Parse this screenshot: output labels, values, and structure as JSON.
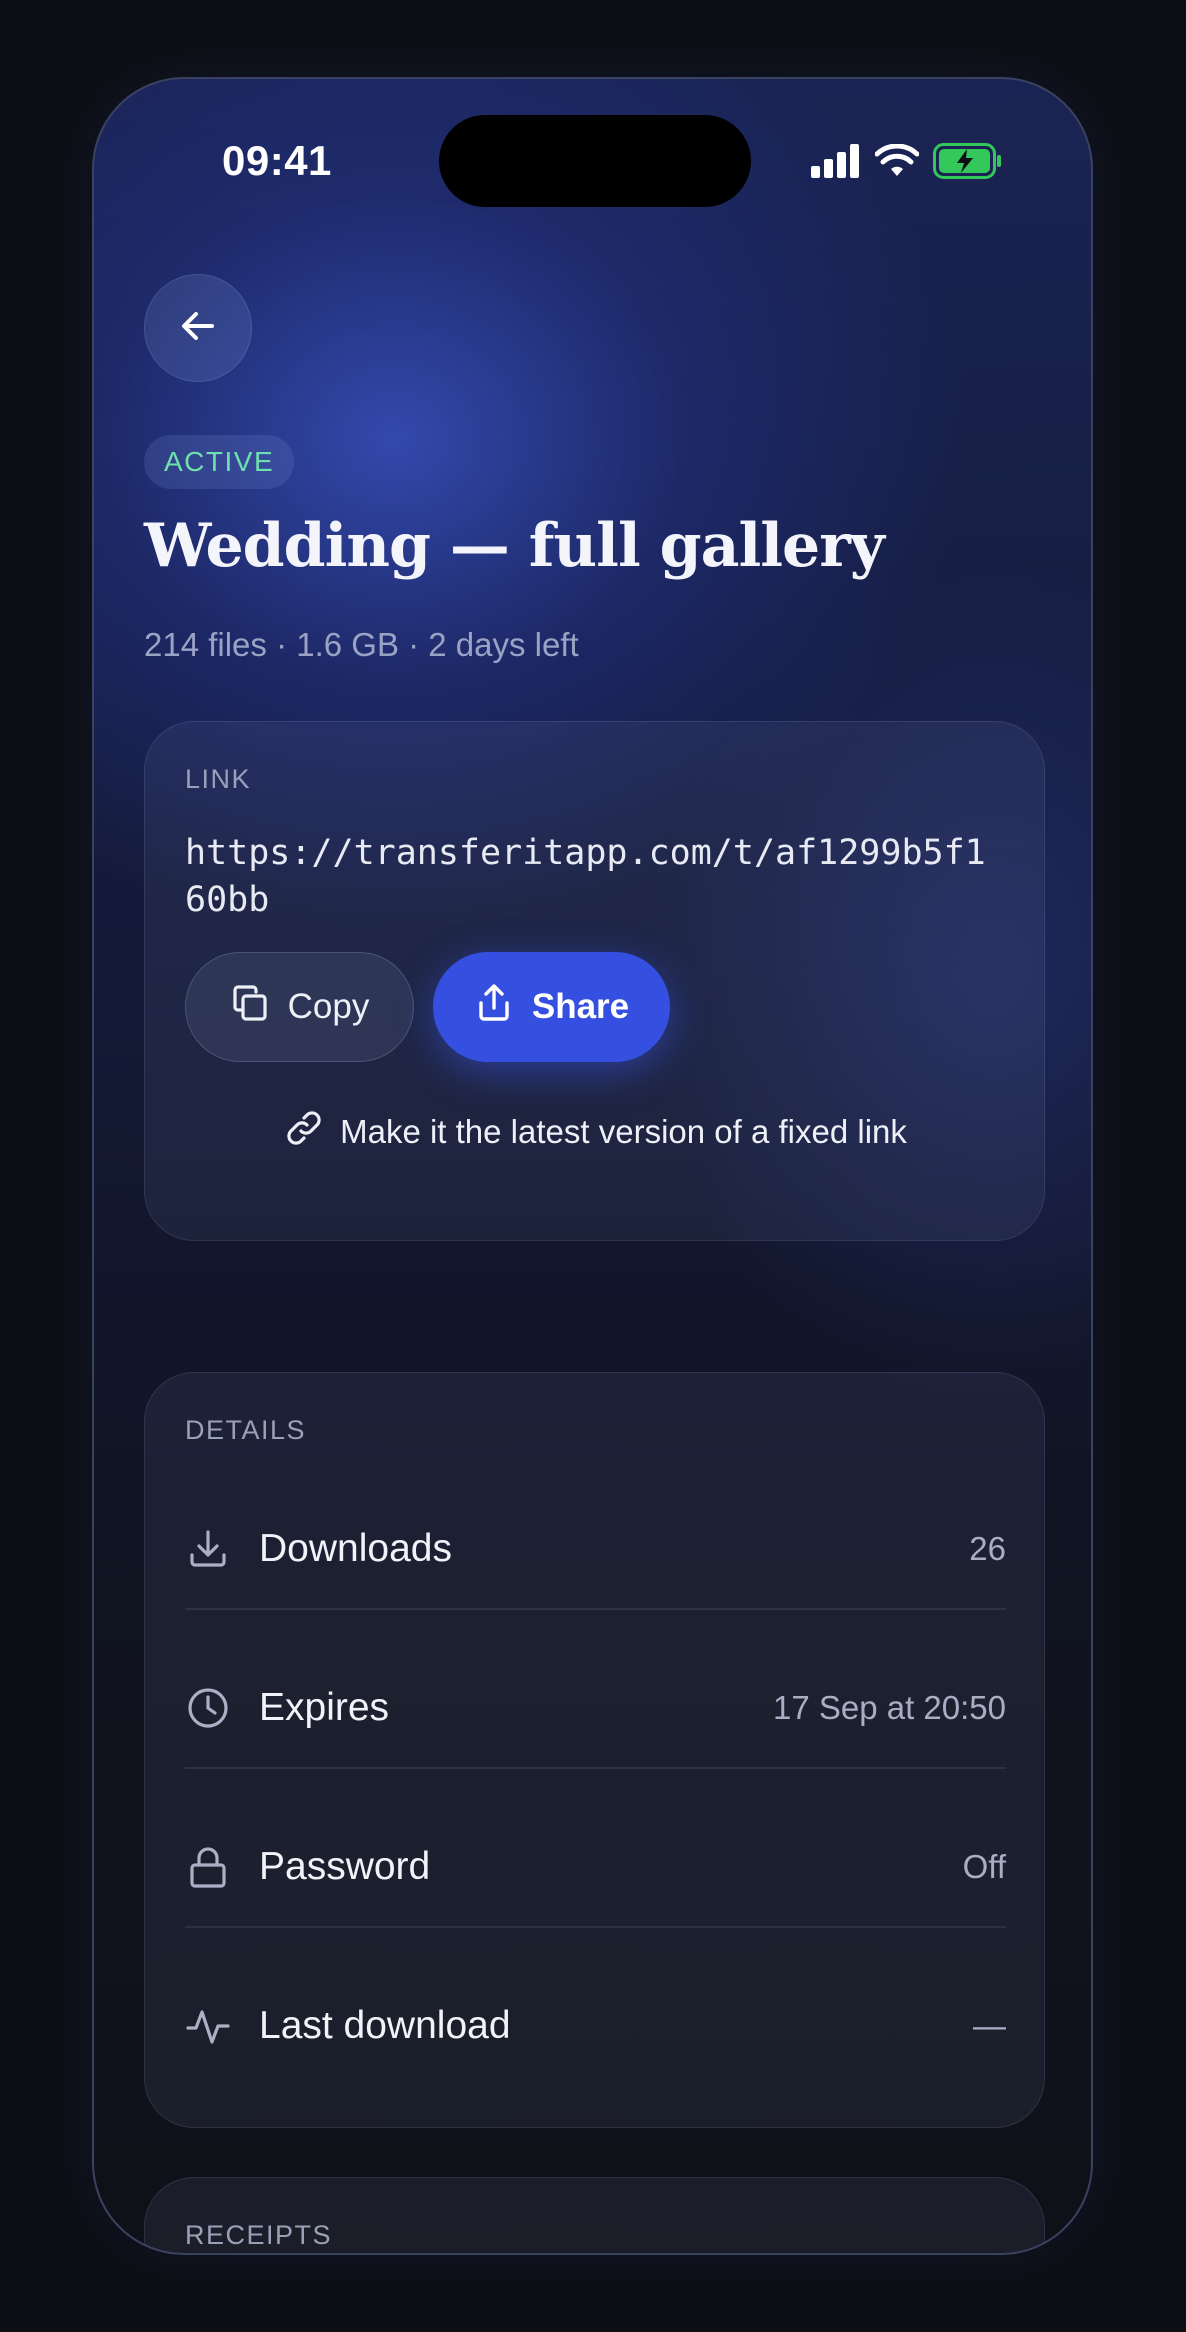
{
  "status_bar": {
    "time": "09:41"
  },
  "header": {
    "status_badge": "ACTIVE",
    "title": "Wedding — full gallery",
    "meta": "214 files · 1.6 GB · 2 days left"
  },
  "link_card": {
    "label": "LINK",
    "url": "https://transferitapp.com/t/af1299b5f160bb",
    "copy_label": "Copy",
    "share_label": "Share",
    "fixed_link_label": "Make it the latest version of a fixed link"
  },
  "details": {
    "label": "DETAILS",
    "rows": [
      {
        "label": "Downloads",
        "value": "26",
        "icon": "download-icon"
      },
      {
        "label": "Expires",
        "value": "17 Sep at 20:50",
        "icon": "clock-icon"
      },
      {
        "label": "Password",
        "value": "Off",
        "icon": "lock-icon"
      },
      {
        "label": "Last download",
        "value": "—",
        "icon": "activity-icon"
      }
    ]
  },
  "receipts": {
    "label": "RECEIPTS"
  },
  "colors": {
    "accent": "#3550e0",
    "active_badge": "#6ee0b0",
    "battery": "#34c759"
  }
}
